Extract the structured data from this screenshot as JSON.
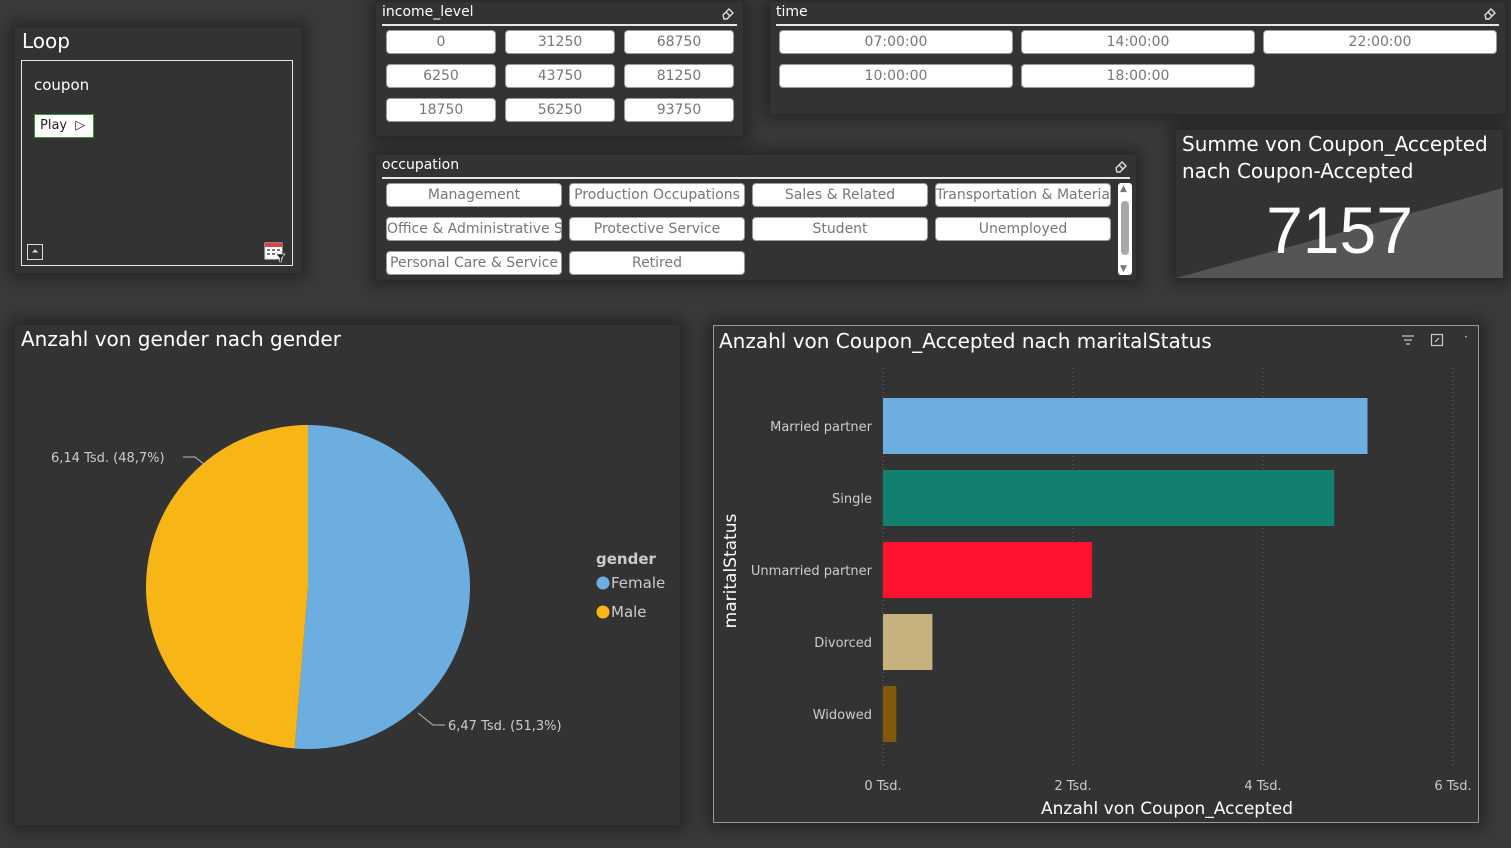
{
  "loop": {
    "title": "Loop",
    "field": "coupon",
    "play_label": "Play"
  },
  "income_slicer": {
    "title": "income_level",
    "tiles": [
      "0",
      "31250",
      "68750",
      "6250",
      "43750",
      "81250",
      "18750",
      "56250",
      "93750"
    ]
  },
  "time_slicer": {
    "title": "time",
    "tiles": [
      "07:00:00",
      "14:00:00",
      "22:00:00",
      "10:00:00",
      "18:00:00"
    ]
  },
  "occupation_slicer": {
    "title": "occupation",
    "tiles": [
      "Management",
      "Production Occupations",
      "Sales & Related",
      "Transportation & Materia",
      "Office & Administrative S",
      "Protective Service",
      "Student",
      "Unemployed",
      "Personal Care & Service",
      "Retired"
    ]
  },
  "kpi": {
    "title_line1": "Summe von Coupon_Accepted",
    "title_line2": "nach Coupon-Accepted",
    "value": "7157"
  },
  "pie": {
    "title": "Anzahl von gender nach gender",
    "legend_title": "gender",
    "label_male": "6,14 Tsd. (48,7%)",
    "label_female": "6,47 Tsd. (51,3%)"
  },
  "bar": {
    "title": "Anzahl von Coupon_Accepted nach maritalStatus",
    "ylabel": "maritalStatus",
    "xlabel": "Anzahl von Coupon_Accepted"
  },
  "chart_data": [
    {
      "type": "pie",
      "title": "Anzahl von gender nach gender",
      "legend_title": "gender",
      "slices": [
        {
          "name": "Female",
          "value": 6470,
          "percent": 51.3,
          "color": "#6caee0"
        },
        {
          "name": "Male",
          "value": 6140,
          "percent": 48.7,
          "color": "#f7b516"
        }
      ]
    },
    {
      "type": "bar",
      "orientation": "horizontal",
      "title": "Anzahl von Coupon_Accepted nach maritalStatus",
      "xlabel": "Anzahl von Coupon_Accepted",
      "ylabel": "maritalStatus",
      "categories": [
        "Married partner",
        "Single",
        "Unmarried partner",
        "Divorced",
        "Widowed"
      ],
      "values": [
        5100,
        4750,
        2200,
        520,
        140
      ],
      "colors": [
        "#6caee0",
        "#12806e",
        "#fe1230",
        "#c6b27f",
        "#7f5a0a"
      ],
      "xlim": [
        0,
        6000
      ],
      "xticks": [
        0,
        2000,
        4000,
        6000
      ],
      "xtick_labels": [
        "0 Tsd.",
        "2 Tsd.",
        "4 Tsd.",
        "6 Tsd."
      ],
      "grid": "vertical-dotted"
    }
  ]
}
